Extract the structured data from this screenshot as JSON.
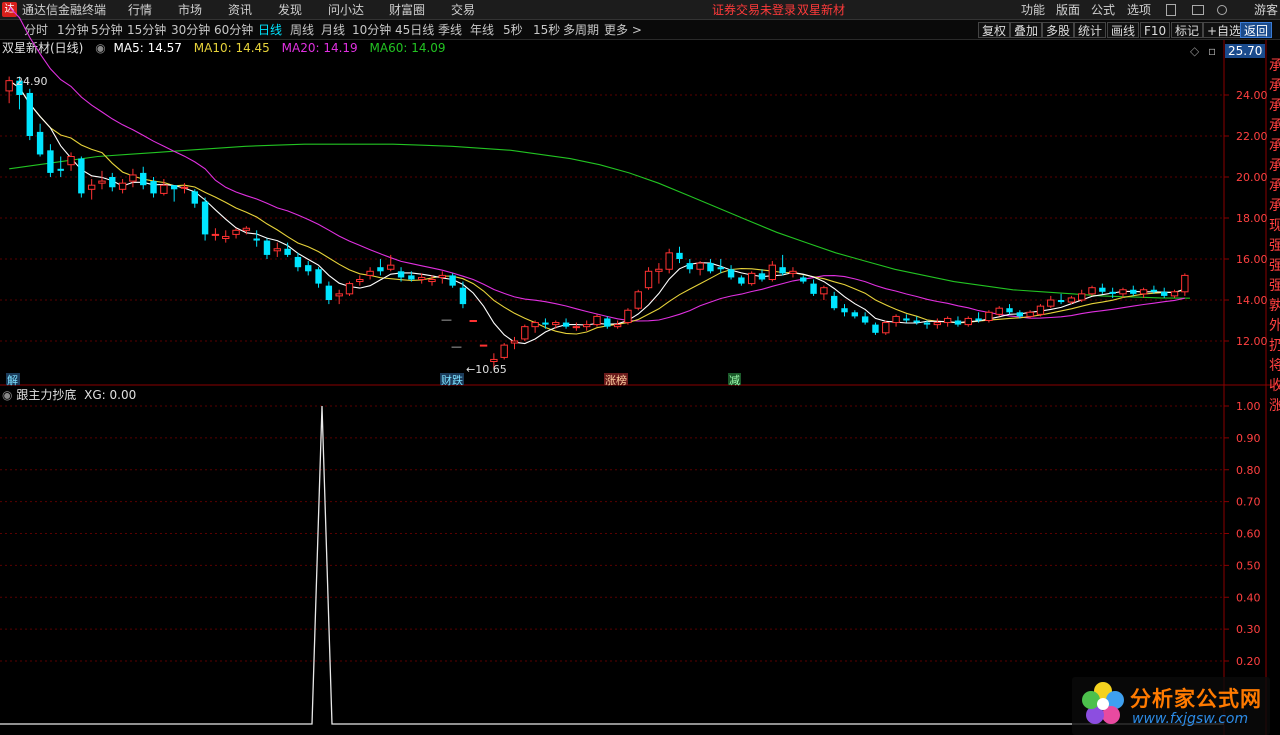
{
  "menubar": {
    "title": "通达信金融终端",
    "menus": [
      "行情",
      "市场",
      "资讯",
      "发现",
      "问小达",
      "财富圈",
      "交易"
    ],
    "status_not_logged": "证券交易未登录",
    "stock_name": "双星新材",
    "right_menus": [
      "功能",
      "版面",
      "公式",
      "选项"
    ],
    "guest": "游客"
  },
  "periods": [
    "分时",
    "1分钟",
    "5分钟",
    "15分钟",
    "30分钟",
    "60分钟",
    "日线",
    "周线",
    "月线",
    "10分钟",
    "45日线",
    "季线",
    "年线",
    "5秒",
    "15秒",
    "多周期",
    "更多 >"
  ],
  "active_period": "日线",
  "toolbar": [
    "复权",
    "叠加",
    "多股",
    "统计",
    "画线",
    "F10",
    "标记",
    "+自选",
    "返回"
  ],
  "info": {
    "title": "双星新材(日线)",
    "ma5": "MA5: 14.57",
    "ma10": "MA10: 14.45",
    "ma20": "MA20: 14.19",
    "ma60": "MA60: 14.09"
  },
  "price_axis": {
    "current": "25.70",
    "ticks": [
      "24.00",
      "22.00",
      "20.00",
      "18.00",
      "16.00",
      "14.00",
      "12.00"
    ],
    "range": [
      10.0,
      25.7
    ]
  },
  "annotations": {
    "high_label": "24.90",
    "low_label": "10.65",
    "markers": [
      "解",
      "财跌",
      "涨榜",
      "减"
    ]
  },
  "indicator": {
    "title": "跟主力抄底",
    "value": "XG: 0.00",
    "ticks": [
      "1.00",
      "0.90",
      "0.80",
      "0.70",
      "0.60",
      "0.50",
      "0.40",
      "0.30",
      "0.20"
    ]
  },
  "right_column_text": "承承承承承承承承现强强强孰外扔将收涨",
  "watermark": {
    "title": "分析家公式网",
    "url": "www.fxjgsw.com"
  },
  "colors": {
    "up": "#ff3232",
    "down": "#00e5ff",
    "ma5": "#ffffff",
    "ma10": "#e6d23a",
    "ma20": "#e030e0",
    "ma60": "#22c322",
    "grid": "#5a0000",
    "axis_text": "#ff4040"
  },
  "chart_data": {
    "type": "candlestick",
    "candles": [
      [
        24.2,
        24.9,
        23.6,
        24.7
      ],
      [
        24.7,
        24.9,
        23.3,
        24.0
      ],
      [
        24.1,
        24.3,
        21.8,
        22.0
      ],
      [
        22.2,
        22.6,
        21.0,
        21.1
      ],
      [
        21.3,
        21.6,
        20.0,
        20.2
      ],
      [
        20.4,
        21.0,
        20.0,
        20.3
      ],
      [
        20.6,
        21.2,
        20.3,
        21.0
      ],
      [
        20.9,
        21.0,
        19.0,
        19.2
      ],
      [
        19.4,
        19.9,
        18.9,
        19.6
      ],
      [
        19.7,
        20.3,
        19.4,
        19.8
      ],
      [
        20.0,
        20.2,
        19.3,
        19.5
      ],
      [
        19.4,
        19.9,
        19.2,
        19.7
      ],
      [
        19.8,
        20.4,
        19.5,
        20.1
      ],
      [
        20.2,
        20.5,
        19.4,
        19.6
      ],
      [
        19.8,
        20.0,
        19.0,
        19.2
      ],
      [
        19.2,
        19.9,
        19.1,
        19.6
      ],
      [
        19.6,
        19.6,
        18.8,
        19.4
      ],
      [
        19.5,
        19.7,
        19.2,
        19.5
      ],
      [
        19.3,
        19.4,
        18.5,
        18.7
      ],
      [
        18.8,
        19.0,
        16.9,
        17.2
      ],
      [
        17.2,
        17.5,
        16.9,
        17.2
      ],
      [
        17.0,
        17.4,
        16.8,
        17.1
      ],
      [
        17.2,
        17.5,
        17.0,
        17.4
      ],
      [
        17.4,
        17.6,
        17.2,
        17.5
      ],
      [
        17.0,
        17.4,
        16.6,
        16.9
      ],
      [
        16.9,
        17.0,
        16.0,
        16.2
      ],
      [
        16.4,
        16.8,
        16.1,
        16.5
      ],
      [
        16.5,
        16.8,
        16.1,
        16.2
      ],
      [
        16.1,
        16.3,
        15.4,
        15.6
      ],
      [
        15.7,
        15.9,
        15.2,
        15.4
      ],
      [
        15.5,
        15.6,
        14.6,
        14.8
      ],
      [
        14.7,
        14.9,
        13.8,
        14.0
      ],
      [
        14.2,
        14.5,
        13.8,
        14.3
      ],
      [
        14.3,
        14.9,
        14.2,
        14.8
      ],
      [
        14.9,
        15.2,
        14.7,
        15.0
      ],
      [
        15.2,
        15.6,
        15.0,
        15.4
      ],
      [
        15.6,
        16.0,
        15.2,
        15.4
      ],
      [
        15.5,
        16.2,
        15.4,
        15.7
      ],
      [
        15.4,
        15.6,
        14.9,
        15.1
      ],
      [
        15.2,
        15.4,
        14.9,
        15.0
      ],
      [
        15.0,
        15.3,
        14.8,
        15.1
      ],
      [
        14.9,
        15.2,
        14.7,
        15.0
      ],
      [
        15.1,
        15.4,
        14.8,
        15.2
      ],
      [
        15.2,
        15.3,
        14.6,
        14.7
      ],
      [
        14.6,
        14.9,
        13.6,
        13.8
      ],
      [
        13.0,
        13.0,
        13.0,
        13.0
      ],
      [
        11.8,
        11.8,
        11.8,
        11.8
      ],
      [
        11.0,
        11.4,
        10.65,
        11.1
      ],
      [
        11.2,
        11.9,
        11.1,
        11.8
      ],
      [
        11.9,
        12.2,
        11.6,
        12.0
      ],
      [
        12.1,
        12.8,
        12.0,
        12.7
      ],
      [
        12.7,
        13.0,
        12.4,
        12.9
      ],
      [
        12.9,
        13.1,
        12.6,
        12.8
      ],
      [
        12.8,
        13.0,
        12.6,
        12.9
      ],
      [
        12.9,
        13.1,
        12.6,
        12.7
      ],
      [
        12.7,
        12.9,
        12.5,
        12.7
      ],
      [
        12.7,
        13.0,
        12.5,
        12.8
      ],
      [
        12.8,
        13.3,
        12.7,
        13.2
      ],
      [
        13.1,
        13.2,
        12.6,
        12.7
      ],
      [
        12.7,
        13.0,
        12.6,
        12.8
      ],
      [
        12.9,
        13.6,
        12.8,
        13.5
      ],
      [
        13.6,
        14.5,
        13.5,
        14.4
      ],
      [
        14.6,
        15.6,
        14.5,
        15.4
      ],
      [
        15.4,
        15.8,
        14.8,
        15.5
      ],
      [
        15.5,
        16.5,
        15.3,
        16.3
      ],
      [
        16.3,
        16.6,
        15.8,
        16.0
      ],
      [
        15.8,
        16.0,
        15.3,
        15.5
      ],
      [
        15.5,
        15.9,
        15.2,
        15.8
      ],
      [
        15.8,
        16.0,
        15.3,
        15.4
      ],
      [
        15.6,
        16.0,
        15.3,
        15.5
      ],
      [
        15.5,
        15.7,
        15.0,
        15.1
      ],
      [
        15.1,
        15.2,
        14.7,
        14.8
      ],
      [
        14.8,
        15.4,
        14.7,
        15.3
      ],
      [
        15.3,
        15.5,
        14.9,
        15.0
      ],
      [
        15.0,
        15.9,
        14.9,
        15.7
      ],
      [
        15.6,
        16.2,
        15.2,
        15.3
      ],
      [
        15.3,
        15.6,
        15.1,
        15.4
      ],
      [
        15.1,
        15.2,
        14.8,
        14.9
      ],
      [
        14.8,
        15.0,
        14.2,
        14.3
      ],
      [
        14.3,
        14.7,
        14.0,
        14.6
      ],
      [
        14.2,
        14.4,
        13.5,
        13.6
      ],
      [
        13.6,
        13.8,
        13.2,
        13.4
      ],
      [
        13.4,
        13.5,
        13.1,
        13.2
      ],
      [
        13.2,
        13.4,
        12.8,
        12.9
      ],
      [
        12.8,
        12.9,
        12.3,
        12.4
      ],
      [
        12.4,
        13.0,
        12.3,
        12.9
      ],
      [
        12.9,
        13.3,
        12.7,
        13.2
      ],
      [
        13.1,
        13.3,
        12.9,
        13.0
      ],
      [
        13.0,
        13.2,
        12.8,
        12.9
      ],
      [
        12.9,
        13.0,
        12.6,
        12.8
      ],
      [
        12.8,
        13.1,
        12.6,
        12.9
      ],
      [
        12.9,
        13.2,
        12.7,
        13.1
      ],
      [
        13.0,
        13.2,
        12.7,
        12.8
      ],
      [
        12.8,
        13.2,
        12.7,
        13.1
      ],
      [
        13.1,
        13.4,
        12.9,
        13.0
      ],
      [
        13.0,
        13.5,
        12.9,
        13.4
      ],
      [
        13.3,
        13.7,
        13.2,
        13.6
      ],
      [
        13.6,
        13.8,
        13.3,
        13.4
      ],
      [
        13.4,
        13.5,
        13.1,
        13.2
      ],
      [
        13.2,
        13.5,
        13.1,
        13.4
      ],
      [
        13.3,
        13.8,
        13.2,
        13.7
      ],
      [
        13.7,
        14.2,
        13.6,
        14.0
      ],
      [
        14.0,
        14.3,
        13.8,
        13.9
      ],
      [
        13.9,
        14.2,
        13.8,
        14.1
      ],
      [
        14.0,
        14.5,
        13.9,
        14.3
      ],
      [
        14.3,
        14.7,
        14.2,
        14.6
      ],
      [
        14.6,
        14.8,
        14.3,
        14.4
      ],
      [
        14.4,
        14.6,
        14.1,
        14.3
      ],
      [
        14.3,
        14.6,
        14.1,
        14.5
      ],
      [
        14.5,
        14.7,
        14.2,
        14.3
      ],
      [
        14.3,
        14.6,
        14.1,
        14.5
      ],
      [
        14.5,
        14.7,
        14.3,
        14.4
      ],
      [
        14.4,
        14.6,
        14.1,
        14.2
      ],
      [
        14.2,
        14.5,
        14.1,
        14.4
      ],
      [
        14.4,
        15.3,
        14.2,
        15.2
      ]
    ],
    "ma60": [
      20.4,
      20.6,
      20.8,
      21.0,
      21.1,
      21.2,
      21.3,
      21.4,
      21.5,
      21.55,
      21.6,
      21.6,
      21.6,
      21.6,
      21.55,
      21.5,
      21.4,
      21.3,
      21.1,
      20.9,
      20.6,
      20.2,
      19.7,
      19.1,
      18.5,
      17.9,
      17.3,
      16.8,
      16.3,
      15.9,
      15.5,
      15.2,
      14.9,
      14.7,
      14.5,
      14.4,
      14.3,
      14.2,
      14.15,
      14.1,
      14.09
    ]
  },
  "indicator_data": {
    "type": "line",
    "values": [
      0,
      0,
      0,
      0,
      0,
      0,
      0,
      0,
      0,
      0,
      0,
      0,
      0,
      0,
      0,
      0,
      0,
      0,
      0,
      0,
      0,
      0,
      0,
      0,
      0,
      0,
      0,
      0,
      0,
      0,
      0,
      0,
      0,
      0,
      0,
      0,
      0,
      0,
      0,
      0,
      0,
      0,
      0,
      0,
      0,
      0,
      0,
      0,
      0,
      0,
      0,
      0,
      0,
      0,
      0,
      0,
      0,
      0,
      0,
      0,
      0,
      0,
      0,
      0,
      0,
      0,
      0,
      0,
      0,
      0,
      0,
      0,
      0,
      0,
      0,
      0,
      0,
      0,
      0,
      0,
      0,
      0,
      0,
      0,
      0,
      0,
      0,
      0,
      0,
      0,
      0,
      0,
      0,
      0,
      0,
      0,
      0,
      0,
      0,
      0,
      0,
      0,
      0,
      0,
      0,
      0,
      0,
      0,
      0,
      0,
      0,
      0,
      0,
      0,
      0,
      0,
      0,
      0,
      0,
      0,
      0,
      0,
      0,
      0,
      0,
      0,
      0,
      0,
      0,
      0,
      0
    ],
    "peak_index": 30,
    "peak_value": 1.0
  }
}
